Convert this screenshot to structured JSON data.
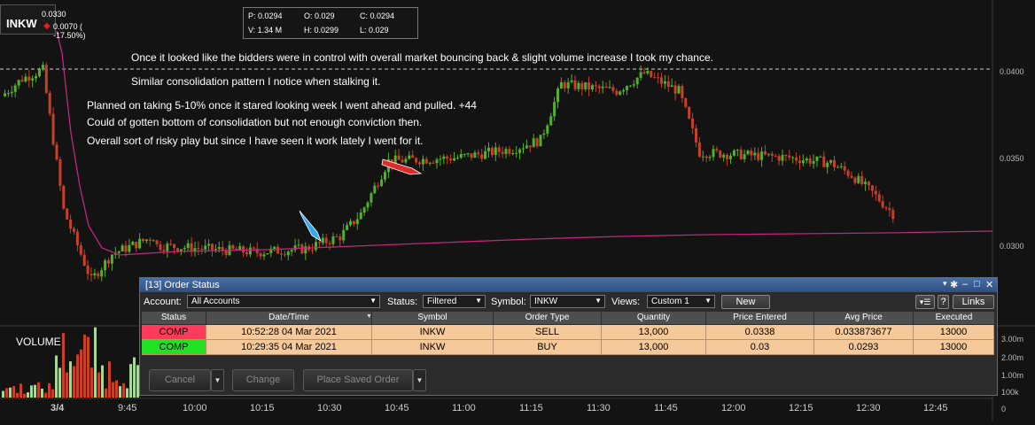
{
  "symbol_panel": {
    "symbol": "INKW",
    "last": "0.0330",
    "change": "0.0070 ( -17.50%)",
    "change_color": "#e02020"
  },
  "ohlc_box": {
    "p": "P: 0.0294",
    "o": "O: 0.029",
    "c": "C: 0.0294",
    "v": "V: 1.34 M",
    "h": "H: 0.0299",
    "l": "L: 0.029"
  },
  "annotations": [
    "Once it looked like the bidders were in control with overall market bouncing back & slight volume increase I took my chance.",
    "Similar consolidation pattern I notice when stalking it.",
    "Planned on taking 5-10% once it stared looking week I went ahead and pulled. +44",
    "Could of gotten bottom of consolidation but not enough conviction then.",
    "Overall sort of risky play but since I have seen it work lately I went for it."
  ],
  "price_axis": [
    "0.0400",
    "0.0350",
    "0.0300"
  ],
  "volume_axis": [
    "3.00m",
    "2.00m",
    "1.00m",
    "100k",
    "0"
  ],
  "volume_title": "VOLUME",
  "time_axis": [
    "3/4",
    "9:45",
    "10:00",
    "10:15",
    "10:30",
    "10:45",
    "11:00",
    "11:15",
    "11:30",
    "11:45",
    "12:00",
    "12:15",
    "12:30",
    "12:45"
  ],
  "colors": {
    "up_candle": "#54b02a",
    "down_candle": "#c8402a",
    "vwap_line": "#c0287a",
    "order_row_bg": "#f6c99a",
    "sell_status_bg": "#ff3a5a",
    "buy_status_bg": "#22e022"
  },
  "order_window": {
    "title": "[13] Order Status",
    "account_label": "Account:",
    "account_value": "All Accounts",
    "status_label": "Status:",
    "status_value": "Filtered",
    "symbol_label": "Symbol:",
    "symbol_value": "INKW",
    "views_label": "Views:",
    "views_value": "Custom 1",
    "new_button": "New",
    "help_button": "?",
    "links_button": "Links",
    "columns": [
      "Status",
      "Date/Time",
      "Symbol",
      "Order Type",
      "Quantity",
      "Price Entered",
      "Avg Price",
      "Executed"
    ],
    "rows": [
      {
        "status": "COMP",
        "datetime": "10:52:28 04 Mar 2021",
        "symbol": "INKW",
        "order_type": "SELL",
        "quantity": "13,000",
        "price_entered": "0.0338",
        "avg_price": "0.033873677",
        "executed": "13000"
      },
      {
        "status": "COMP",
        "datetime": "10:29:35 04 Mar 2021",
        "symbol": "INKW",
        "order_type": "BUY",
        "quantity": "13,000",
        "price_entered": "0.03",
        "avg_price": "0.0293",
        "executed": "13000"
      }
    ],
    "cancel_button": "Cancel",
    "change_button": "Change",
    "place_saved_button": "Place Saved Order"
  }
}
